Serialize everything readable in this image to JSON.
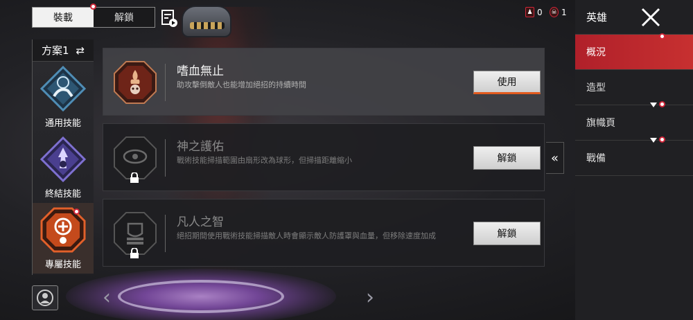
{
  "top_tabs": [
    {
      "label": "裝載",
      "active": true
    },
    {
      "label": "解鎖",
      "active": false
    }
  ],
  "status": {
    "count_a": "0",
    "count_b": "1"
  },
  "loadout": {
    "label": "方案1"
  },
  "slots": [
    {
      "label": "通用技能",
      "icon": "crawl-perk-icon",
      "color": "#3f6a8a"
    },
    {
      "label": "終結技能",
      "icon": "finisher-perk-icon",
      "color": "#5a4fa0"
    },
    {
      "label": "專屬技能",
      "icon": "exclusive-perk-icon",
      "color": "#d1501f"
    }
  ],
  "cards": [
    {
      "title": "嗜血無止",
      "desc": "助攻擊倒敵人也能增加絕招的持續時間",
      "button": "使用",
      "locked": false
    },
    {
      "title": "神之護佑",
      "desc": "戰術技能掃描範圍由扇形改為球形，但掃描距離縮小",
      "button": "解鎖",
      "locked": true
    },
    {
      "title": "凡人之智",
      "desc": "絕招期間使用戰術技能掃描敵人時會顯示敵人防護罩與血量，但移除速度加成",
      "button": "解鎖",
      "locked": true
    }
  ],
  "right_nav": {
    "header": "英雄",
    "items": [
      {
        "label": "概況",
        "active": true
      },
      {
        "label": "造型",
        "active": false
      },
      {
        "label": "旗幟頁",
        "active": false
      },
      {
        "label": "戰備",
        "active": false
      }
    ]
  },
  "colors": {
    "accent_red": "#c73030",
    "accent_orange": "#e25a1e"
  }
}
